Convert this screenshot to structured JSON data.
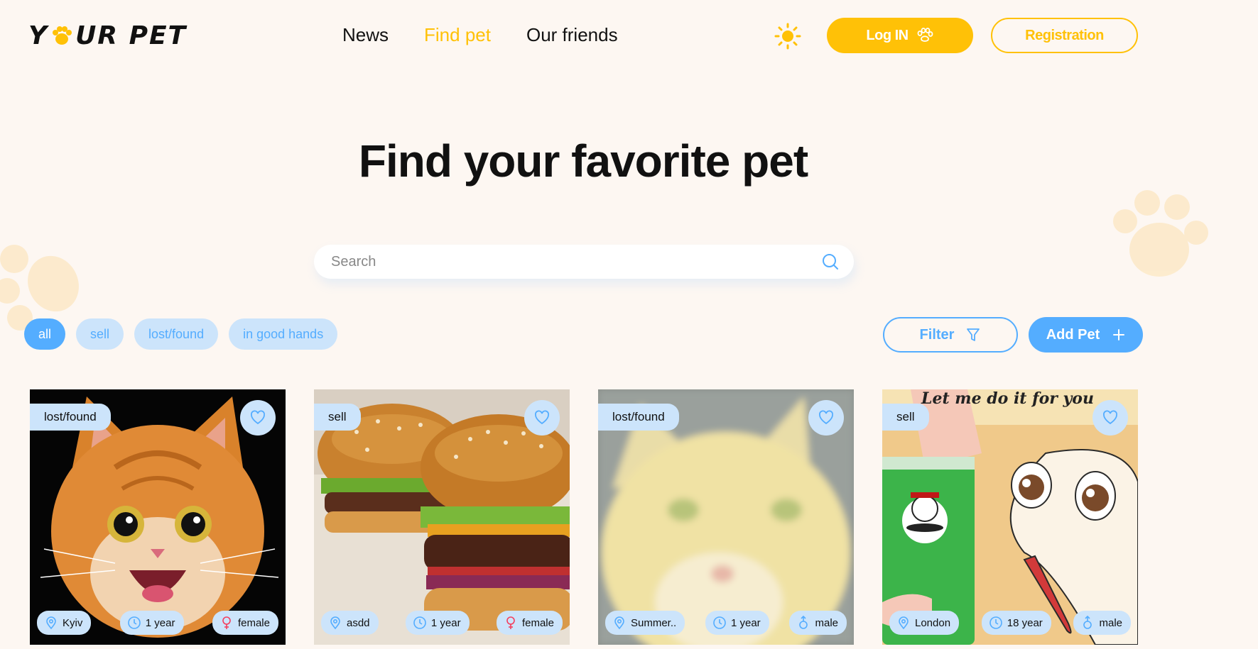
{
  "header": {
    "logo_left": "Y",
    "logo_right": "UR PET",
    "nav": [
      {
        "label": "News",
        "active": false
      },
      {
        "label": "Find pet",
        "active": true
      },
      {
        "label": "Our friends",
        "active": false
      }
    ],
    "login_label": "Log IN",
    "register_label": "Registration"
  },
  "main": {
    "title": "Find your favorite pet",
    "search_placeholder": "Search",
    "chips": [
      {
        "label": "all",
        "active": true
      },
      {
        "label": "sell",
        "active": false
      },
      {
        "label": "lost/found",
        "active": false
      },
      {
        "label": "in good hands",
        "active": false
      }
    ],
    "filter_label": "Filter",
    "add_pet_label": "Add Pet"
  },
  "cards": [
    {
      "category": "lost/found",
      "image": "orange-cat-photo",
      "location": "Kyiv",
      "age": "1 year",
      "gender": "female"
    },
    {
      "category": "sell",
      "image": "burgers-photo",
      "location": "asdd",
      "age": "1 year",
      "gender": "female"
    },
    {
      "category": "lost/found",
      "image": "blurry-cat-photo",
      "location": "Summer..",
      "age": "1 year",
      "gender": "male"
    },
    {
      "category": "sell",
      "image": "cartoon-dog-pringles",
      "caption": "Let me do it for you",
      "location": "London",
      "age": "18 year",
      "gender": "male"
    }
  ],
  "colors": {
    "background": "#FDF7F2",
    "accent_yellow": "#FFC107",
    "accent_blue": "#54ADFF",
    "light_blue": "#CCE4FB",
    "female": "#F43F5E"
  }
}
